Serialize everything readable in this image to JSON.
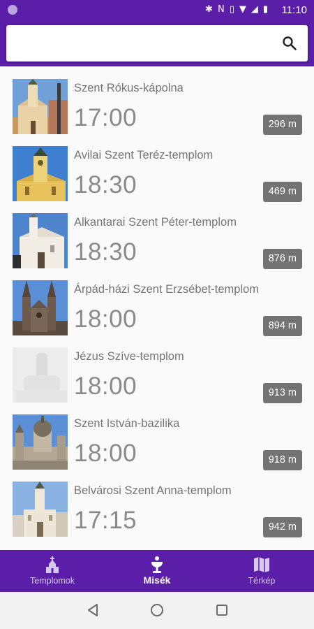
{
  "status": {
    "time": "11:10",
    "icons": [
      "bluetooth-icon",
      "nfc-icon",
      "vibrate-icon",
      "wifi-icon",
      "signal-icon",
      "battery-icon"
    ]
  },
  "search": {
    "placeholder": "",
    "value": ""
  },
  "masses": [
    {
      "name": "Szent Rókus-kápolna",
      "time": "17:00",
      "distance": "296 m"
    },
    {
      "name": "Avilai Szent Teréz-templom",
      "time": "18:30",
      "distance": "469 m"
    },
    {
      "name": "Alkantarai Szent Péter-templom",
      "time": "18:30",
      "distance": "876 m"
    },
    {
      "name": "Árpád-házi Szent Erzsébet-templom",
      "time": "18:00",
      "distance": "894 m"
    },
    {
      "name": "Jézus Szíve-templom",
      "time": "18:00",
      "distance": "913 m"
    },
    {
      "name": "Szent István-bazilika",
      "time": "18:00",
      "distance": "918 m"
    },
    {
      "name": "Belvárosi Szent Anna-templom",
      "time": "17:15",
      "distance": "942 m"
    }
  ],
  "nav": {
    "items": [
      {
        "label": "Templomok",
        "icon": "church-icon",
        "active": false
      },
      {
        "label": "Misék",
        "icon": "chalice-icon",
        "active": true
      },
      {
        "label": "Térkép",
        "icon": "map-icon",
        "active": false
      }
    ]
  },
  "colors": {
    "primary": "#5a1ea8",
    "badge": "#737373",
    "inactive_nav": "#d6c8ef"
  }
}
